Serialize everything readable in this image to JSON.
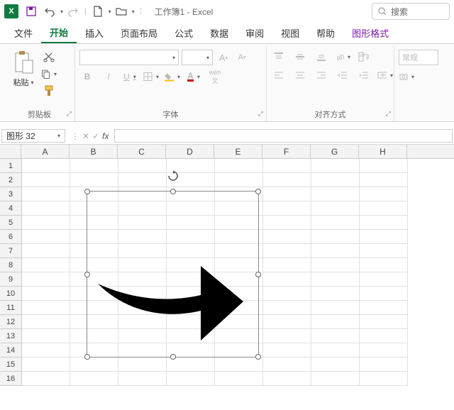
{
  "titlebar": {
    "app_glyph": "X",
    "doc_title": "工作簿1 - Excel",
    "search_placeholder": "搜索"
  },
  "tabs": {
    "file": "文件",
    "home": "开始",
    "insert": "插入",
    "layout": "页面布局",
    "formulas": "公式",
    "data": "数据",
    "review": "审阅",
    "view": "视图",
    "help": "帮助",
    "shape_format": "图形格式"
  },
  "ribbon": {
    "clipboard": {
      "paste": "粘贴",
      "label": "剪贴板"
    },
    "font": {
      "label": "字体",
      "wen": "wén"
    },
    "align": {
      "label": "对齐方式",
      "general": "常规"
    }
  },
  "formula_bar": {
    "name_box": "图形 32",
    "fx": "fx"
  },
  "sheet": {
    "cols": [
      "A",
      "B",
      "C",
      "D",
      "E",
      "F",
      "G",
      "H"
    ],
    "rows": [
      "1",
      "2",
      "3",
      "4",
      "5",
      "6",
      "7",
      "8",
      "9",
      "10",
      "11",
      "12",
      "13",
      "14",
      "15",
      "16"
    ]
  }
}
